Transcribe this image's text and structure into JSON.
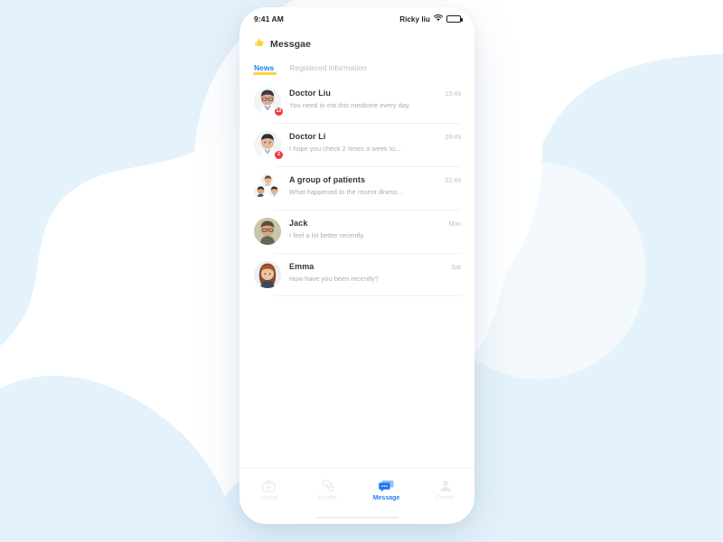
{
  "background": {
    "page_color": "#ffffff",
    "blob_color": "#e4f2fb",
    "blob_color_soft": "#eef7fc"
  },
  "phone": {
    "frame_color": "#ffffff",
    "accent_blue": "#2a7df0",
    "highlight_yellow": "#ffd633",
    "badge_red": "#f0383c"
  },
  "status_bar": {
    "time": "9:41 AM",
    "carrier": "Ricky liu",
    "wifi_icon": "wifi-icon",
    "battery_icon": "battery-icon"
  },
  "header": {
    "icon": "thumbs-up-icon",
    "title": "Messgae"
  },
  "tabs": [
    {
      "label": "News",
      "active": true
    },
    {
      "label": "Registered information",
      "active": false
    }
  ],
  "messages": [
    {
      "avatar": "doctor-liu-avatar",
      "name": "Doctor Liu",
      "preview": "You need to eat this medicine every day.",
      "time": "15:49",
      "badge": "12",
      "group": false
    },
    {
      "avatar": "doctor-li-avatar",
      "name": "Doctor Li",
      "preview": "I hope you check 2 times a week to...",
      "time": "09:49",
      "badge": "2",
      "group": false
    },
    {
      "avatar": "group-avatar",
      "name": "A group of patients",
      "preview": "What happened to the recent illness...",
      "time": "02:49",
      "badge": "",
      "group": true
    },
    {
      "avatar": "jack-avatar",
      "name": "Jack",
      "preview": "I feel a lot better recently.",
      "time": "Mon",
      "badge": "",
      "group": false
    },
    {
      "avatar": "emma-avatar",
      "name": "Emma",
      "preview": "How have you been recently?",
      "time": "Sat",
      "badge": "",
      "group": false
    }
  ],
  "bottom_nav": [
    {
      "label": "Home",
      "icon": "medical-bag-icon",
      "active": false
    },
    {
      "label": "Health",
      "icon": "capsule-pill-icon",
      "active": false
    },
    {
      "label": "Message",
      "icon": "chat-bubble-icon",
      "active": true
    },
    {
      "label": "Centre",
      "icon": "user-person-icon",
      "active": false
    }
  ]
}
